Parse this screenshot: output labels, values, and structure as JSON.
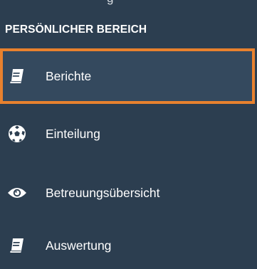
{
  "top_partial_text": "g",
  "section": {
    "title": "PERSÖNLICHER BEREICH"
  },
  "menu": {
    "items": [
      {
        "label": "Berichte",
        "icon": "book-icon",
        "active": true
      },
      {
        "label": "Einteilung",
        "icon": "soccer-ball-icon",
        "active": false
      },
      {
        "label": "Betreuungsübersicht",
        "icon": "eye-icon",
        "active": false
      },
      {
        "label": "Auswertung",
        "icon": "book-icon",
        "active": false
      }
    ]
  },
  "colors": {
    "sidebar_bg": "#2c3e50",
    "active_bg": "#34495e",
    "active_border": "#e8812e",
    "text": "#ffffff"
  }
}
